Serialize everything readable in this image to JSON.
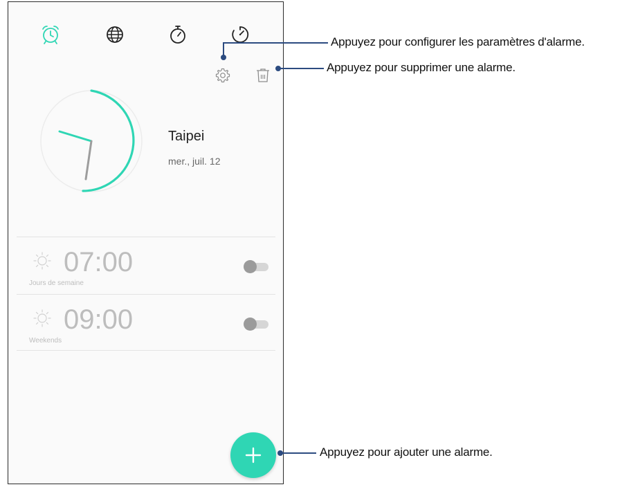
{
  "tabs": [
    {
      "icon": "alarm-clock-icon",
      "active": true
    },
    {
      "icon": "globe-icon",
      "active": false
    },
    {
      "icon": "stopwatch-icon",
      "active": false
    },
    {
      "icon": "timer-icon",
      "active": false
    }
  ],
  "colors": {
    "accent": "#2fd6b4",
    "callout": "#2c4b80",
    "muted": "#bdbdbd"
  },
  "world_clock": {
    "city": "Taipei",
    "date": "mer., juil. 12"
  },
  "alarms": [
    {
      "time": "07:00",
      "label": "Jours de semaine",
      "enabled": false
    },
    {
      "time": "09:00",
      "label": "Weekends",
      "enabled": false
    }
  ],
  "callouts": {
    "settings": "Appuyez pour configurer les paramètres d'alarme.",
    "delete": "Appuyez pour supprimer une alarme.",
    "add": "Appuyez pour ajouter une alarme."
  }
}
